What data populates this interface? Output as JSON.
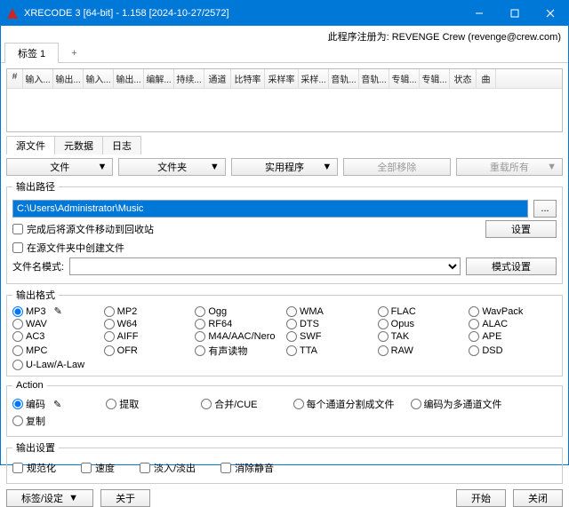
{
  "titlebar": {
    "title": "XRECODE 3 [64-bit] - 1.158 [2024-10-27/2572]"
  },
  "registration": "此程序注册为: REVENGE Crew (revenge@crew.com)",
  "tabs": {
    "tab1": "标签 1",
    "add": "+"
  },
  "grid": {
    "cols": [
      "#",
      "输入...",
      "输出...",
      "输入...",
      "输出...",
      "编解...",
      "持续...",
      "通道",
      "比特率",
      "采样率",
      "采样...",
      "音轨...",
      "音轨...",
      "专辑...",
      "专辑...",
      "状态",
      "曲"
    ]
  },
  "subtabs": {
    "src": "源文件",
    "meta": "元数据",
    "log": "日志"
  },
  "toolbar": {
    "file": "文件",
    "folder": "文件夹",
    "util": "实用程序",
    "removeall": "全部移除",
    "resetall": "重载所有"
  },
  "output": {
    "legend": "输出路径",
    "path": "C:\\Users\\Administrator\\Music",
    "recycle": "完成后将源文件移动到回收站",
    "createdir": "在源文件夹中创建文件",
    "patternLabel": "文件名模式:",
    "settings": "设置",
    "patternSettings": "模式设置"
  },
  "formats": {
    "legend": "输出格式",
    "mp3": "MP3",
    "mp2": "MP2",
    "ogg": "Ogg",
    "wma": "WMA",
    "flac": "FLAC",
    "wavpack": "WavPack",
    "wav": "WAV",
    "w64": "W64",
    "rf64": "RF64",
    "dts": "DTS",
    "opus": "Opus",
    "alac": "ALAC",
    "ac3": "AC3",
    "aiff": "AIFF",
    "m4a": "M4A/AAC/Nero",
    "swf": "SWF",
    "tak": "TAK",
    "ape": "APE",
    "mpc": "MPC",
    "ofr": "OFR",
    "audiobook": "有声读物",
    "tta": "TTA",
    "raw": "RAW",
    "dsd": "DSD",
    "ulaw": "U-Law/A-Law"
  },
  "action": {
    "legend": "Action",
    "encode": "编码",
    "extract": "提取",
    "merge": "合并/CUE",
    "splitchan": "每个通道分割成文件",
    "encmulti": "编码为多通道文件",
    "copy": "复制"
  },
  "outset": {
    "legend": "输出设置",
    "normalize": "规范化",
    "speed": "速度",
    "fade": "淡入/淡出",
    "silence": "消除静音"
  },
  "bottom": {
    "tags": "标签/设定",
    "about": "关于",
    "start": "开始",
    "close": "关闭"
  }
}
